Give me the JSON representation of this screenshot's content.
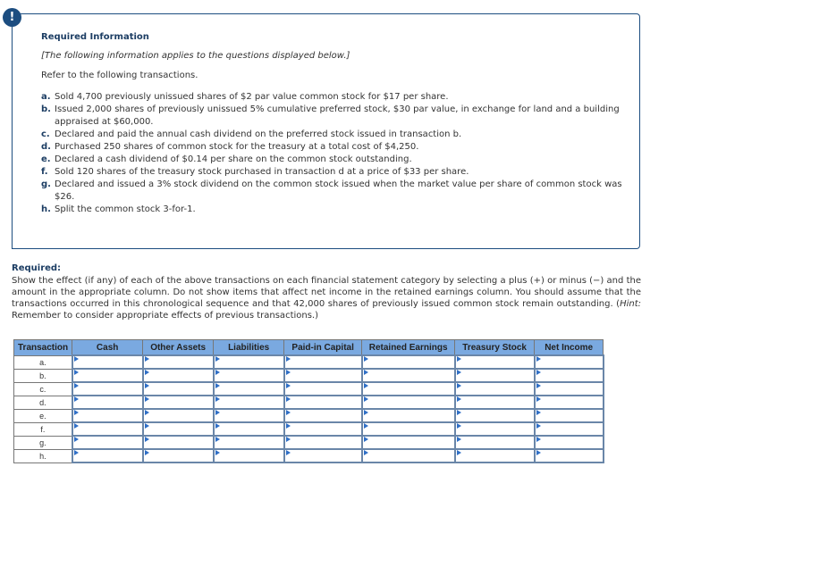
{
  "info": {
    "icon": "exclamation-icon",
    "icon_glyph": "!",
    "title": "Required Information",
    "italic_note": "[The following information applies to the questions displayed below.]",
    "refer": "Refer to the following transactions.",
    "transactions": [
      {
        "letter": "a.",
        "text": "Sold 4,700 previously unissued shares of $2 par value common stock for $17 per share."
      },
      {
        "letter": "b.",
        "text": "Issued 2,000 shares of previously unissued 5% cumulative preferred stock, $30 par value, in exchange for land and a building appraised at $60,000."
      },
      {
        "letter": "c.",
        "text": "Declared and paid the annual cash dividend on the preferred stock issued in transaction b."
      },
      {
        "letter": "d.",
        "text": "Purchased 250 shares of common stock for the treasury at a total cost of $4,250."
      },
      {
        "letter": "e.",
        "text": "Declared a cash dividend of $0.14 per share on the common stock outstanding."
      },
      {
        "letter": "f.",
        "text": "Sold 120 shares of the treasury stock purchased in transaction d at a price of $33 per share."
      },
      {
        "letter": "g.",
        "text": "Declared and issued a 3% stock dividend on the common stock issued when the market value per share of common stock was $26."
      },
      {
        "letter": "h.",
        "text": "Split the common stock 3-for-1."
      }
    ]
  },
  "required": {
    "title": "Required:",
    "text_before_hint": "Show the effect (if any) of each of the above transactions on each financial statement category by selecting a plus (+) or minus (−) and the amount in the appropriate column. Do not show items that affect net income in the retained earnings column. You should assume that the transactions occurred in this chronological sequence and that 42,000 shares of previously issued common stock remain outstanding. (",
    "hint_label": "Hint:",
    "text_after_hint": " Remember to consider appropriate effects of previous transactions.)"
  },
  "table": {
    "headers": [
      "Transaction",
      "Cash",
      "Other Assets",
      "Liabilities",
      "Paid-in Capital",
      "Retained Earnings",
      "Treasury Stock",
      "Net Income"
    ],
    "rows": [
      "a.",
      "b.",
      "c.",
      "d.",
      "e.",
      "f.",
      "g.",
      "h."
    ],
    "cell_values": [
      "",
      "",
      "",
      "",
      "",
      "",
      ""
    ]
  }
}
